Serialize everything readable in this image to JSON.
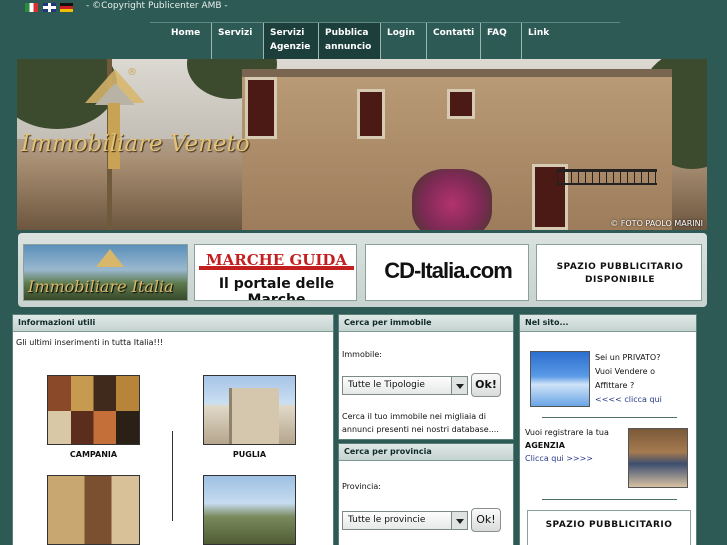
{
  "copyright": "- ©Copyright Publicenter AMB -",
  "languages": [
    "it-flag-icon",
    "uk-flag-icon",
    "de-flag-icon"
  ],
  "nav": [
    {
      "label": "Home"
    },
    {
      "label": "Servizi"
    },
    {
      "label": "Servizi Agenzie"
    },
    {
      "label": "Pubblica annuncio"
    },
    {
      "label": "Login"
    },
    {
      "label": "Contatti"
    },
    {
      "label": "FAQ"
    },
    {
      "label": "Link"
    }
  ],
  "banner": {
    "logo_text": "Immobiliare Veneto",
    "registered": "®",
    "credit": "© FOTO PAOLO MARINI"
  },
  "ads": {
    "immobiliare_italia": "Immobiliare Italia",
    "marche_guida_1": "MARCHE GUIDA",
    "marche_guida_2": "Il portale delle Marche",
    "cd_italia": "CD-Italia.com",
    "spazio_1": "SPAZIO PUBBLICITARIO",
    "spazio_2": "DISPONIBILE"
  },
  "info": {
    "header": "Informazioni utili",
    "intro": "Gli ultimi inserimenti in tutta Italia!!!",
    "regions": [
      {
        "name": "CAMPANIA"
      },
      {
        "name": "PUGLIA"
      }
    ]
  },
  "cerca_immobile": {
    "header": "Cerca per immobile",
    "label": "Immobile:",
    "selected": "Tutte le Tipologie",
    "ok": "Ok!",
    "desc": "Cerca il tuo immobile nei migliaia di annunci presenti nei nostri database...."
  },
  "cerca_provincia": {
    "header": "Cerca per provincia",
    "label": "Provincia:",
    "selected": "Tutte le provincie",
    "ok": "Ok!"
  },
  "nel_sito": {
    "header": "Nel sito...",
    "privato_1": "Sei un PRIVATO?",
    "privato_2": "Vuoi Vendere o",
    "privato_3": "Affittare ?",
    "privato_link": "<<<< clicca qui",
    "agenzia_1": "Vuoi registrare la tua",
    "agenzia_2": "AGENZIA",
    "agenzia_link": "Clicca qui >>>>",
    "spazio": "SPAZIO PUBBLICITARIO"
  }
}
